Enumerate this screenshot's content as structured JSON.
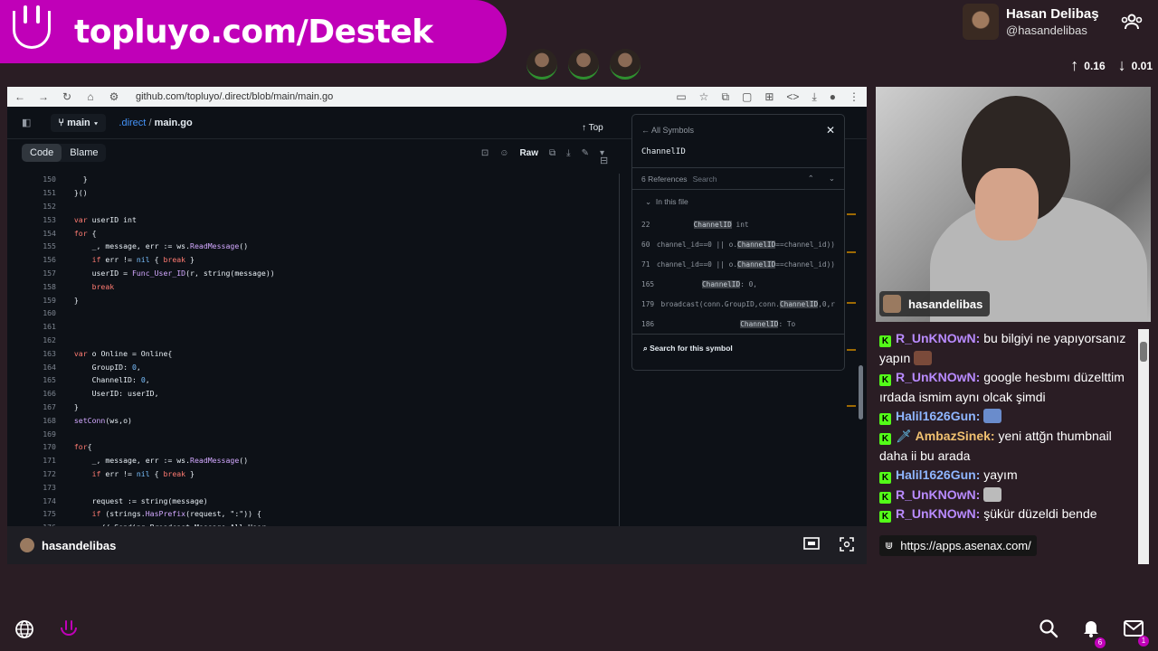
{
  "banner": {
    "text": "topluyo.com/Destek"
  },
  "profile": {
    "name": "Hasan Delibaş",
    "handle": "@hasandelibas"
  },
  "stats": {
    "up": "0.16",
    "down": "0.01"
  },
  "browser": {
    "url": "github.com/topluyo/.direct/blob/main/main.go",
    "branch": "main",
    "path_dir": ".direct",
    "path_sep": "/",
    "path_file": "main.go",
    "top_label": "Top",
    "tab_code": "Code",
    "tab_blame": "Blame",
    "raw_label": "Raw"
  },
  "code_lines": [
    {
      "n": "150",
      "t": "    }"
    },
    {
      "n": "151",
      "t": "  }()"
    },
    {
      "n": "152",
      "t": ""
    },
    {
      "n": "153",
      "t": "  var userID int"
    },
    {
      "n": "154",
      "t": "  for {"
    },
    {
      "n": "155",
      "t": "      _, message, err := ws.ReadMessage()"
    },
    {
      "n": "156",
      "t": "      if err != nil { break }"
    },
    {
      "n": "157",
      "t": "      userID = Func_User_ID(r, string(message))"
    },
    {
      "n": "158",
      "t": "      break"
    },
    {
      "n": "159",
      "t": "  }"
    },
    {
      "n": "160",
      "t": ""
    },
    {
      "n": "161",
      "t": ""
    },
    {
      "n": "162",
      "t": ""
    },
    {
      "n": "163",
      "t": "  var o Online = Online{"
    },
    {
      "n": "164",
      "t": "      GroupID: 0,"
    },
    {
      "n": "165",
      "t": "      ChannelID: 0,"
    },
    {
      "n": "166",
      "t": "      UserID: userID,"
    },
    {
      "n": "167",
      "t": "  }"
    },
    {
      "n": "168",
      "t": "  setConn(ws,o)"
    },
    {
      "n": "169",
      "t": ""
    },
    {
      "n": "170",
      "t": "  for{"
    },
    {
      "n": "171",
      "t": "      _, message, err := ws.ReadMessage()"
    },
    {
      "n": "172",
      "t": "      if err != nil { break }"
    },
    {
      "n": "173",
      "t": ""
    },
    {
      "n": "174",
      "t": "      request := string(message)"
    },
    {
      "n": "175",
      "t": "      if (strings.HasPrefix(request, \":\")) {"
    },
    {
      "n": "176",
      "t": "        // Sending Broadcast Message All User"
    }
  ],
  "symbols": {
    "back_label": "All Symbols",
    "name": "ChannelID",
    "refs_label": "6 References",
    "search_placeholder": "Search",
    "in_file": "In this file",
    "refs": [
      {
        "n": "22",
        "pre": "        ",
        "hl": "ChannelID",
        "post": " int"
      },
      {
        "n": "60",
        "pre": " channel_id==0 || o.",
        "hl": "ChannelID",
        "post": "==channel_id))"
      },
      {
        "n": "71",
        "pre": " channel_id==0 || o.",
        "hl": "ChannelID",
        "post": "==channel_id))"
      },
      {
        "n": "165",
        "pre": "          ",
        "hl": "ChannelID",
        "post": ": 0,"
      },
      {
        "n": "179",
        "pre": " broadcast(conn.GroupID,conn.",
        "hl": "ChannelID",
        "post": ",0,r"
      },
      {
        "n": "186",
        "pre": "                   ",
        "hl": "ChannelID",
        "post": ": To"
      }
    ],
    "search_symbol": "Search for this symbol"
  },
  "footer_user": "hasandelibas",
  "cam_user": "hasandelibas",
  "chat": [
    {
      "user": "R_UnKNOwN:",
      "cls": "u-purple",
      "text": "bu bilgiyi ne yapıyorsanız yapın",
      "emote": "#7a4a3a",
      "sword": false
    },
    {
      "user": "R_UnKNOwN:",
      "cls": "u-purple",
      "text": "google hesbımı düzelttim ırdada ismim aynı olcak şimdi",
      "emote": "",
      "sword": false
    },
    {
      "user": "Halil1626Gun:",
      "cls": "u-blue",
      "text": "",
      "emote": "#6a8ccc",
      "sword": false
    },
    {
      "user": "AmbazSinek:",
      "cls": "u-gold",
      "text": "yeni attğn thumbnail daha ii bu arada",
      "emote": "",
      "sword": true
    },
    {
      "user": "Halil1626Gun:",
      "cls": "u-blue",
      "text": "yayım",
      "emote": "",
      "sword": false
    },
    {
      "user": "R_UnKNOwN:",
      "cls": "u-purple",
      "text": "",
      "emote": "#bbbbbb",
      "sword": false
    },
    {
      "user": "R_UnKNOwN:",
      "cls": "u-purple",
      "text": "şükür düzeldi bende",
      "emote": "",
      "sword": false
    }
  ],
  "link_popup": "https://apps.asenax.com/",
  "notifications": {
    "bell": "6",
    "mail": "1"
  }
}
